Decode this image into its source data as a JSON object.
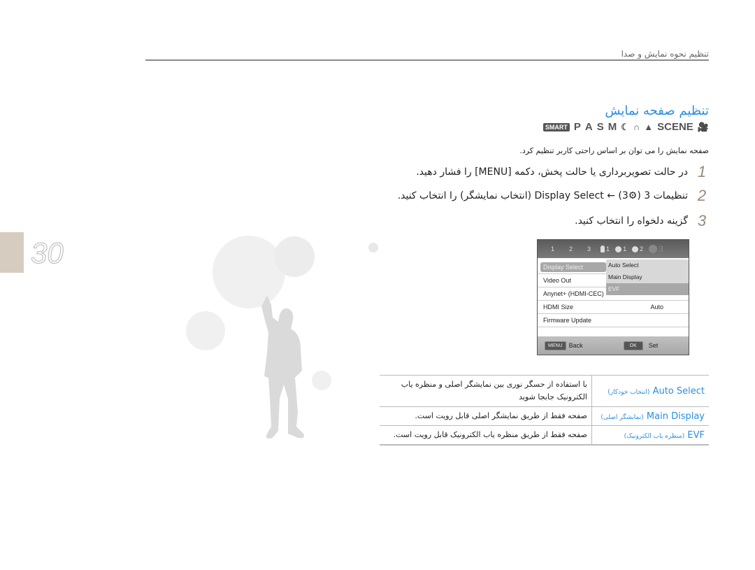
{
  "header": {
    "section_title": "تنظیم نحوه نمایش و صدا"
  },
  "page": {
    "number": "30"
  },
  "content": {
    "title": "تنظیم صفحه نمایش",
    "mode_icons": [
      "smart-mode-icon",
      "P",
      "A",
      "S",
      "M",
      "night-mode-icon",
      "beauty-mode-icon",
      "landscape-mode-icon",
      "SCENE",
      "movie-mode-icon"
    ],
    "mode_labels": {
      "smart": "SMART",
      "p": "P",
      "a": "A",
      "s": "S",
      "m": "M",
      "night": "☾",
      "beauty": "∩",
      "landscape": "▲",
      "scene": "SCENE",
      "movie": "🎥"
    },
    "intro": "صفحه نمایش را می توان بر اساس راحتی کاربر تنظیم کرد.",
    "steps": [
      {
        "num": "1",
        "text": "در حالت تصویربرداری یا حالت پخش، دکمه [MENU] را فشار دهید."
      },
      {
        "num": "2",
        "text": "تنظیمات 3 (⚙3) ← Display Select (انتخاب نمایشگر) را انتخاب کنید."
      },
      {
        "num": "3",
        "text": "گزینه دلخواه را انتخاب کنید."
      }
    ]
  },
  "camera_screen": {
    "tabs": [
      {
        "icon": "camera-icon",
        "label": "1"
      },
      {
        "icon": "camera-icon",
        "label": "2"
      },
      {
        "icon": "camera-icon",
        "label": "3"
      },
      {
        "icon": "person-icon",
        "label": "1"
      },
      {
        "icon": "gear-icon",
        "label": "1"
      },
      {
        "icon": "gear-icon",
        "label": "2"
      },
      {
        "icon": "gear-icon",
        "label": "3"
      }
    ],
    "rows": [
      {
        "label": "Display Select",
        "value": ""
      },
      {
        "label": "Video Out",
        "value": ""
      },
      {
        "label": "Anynet+ (HDMI-CEC)",
        "value": ""
      },
      {
        "label": "HDMI Size",
        "value": "Auto"
      },
      {
        "label": "Firmware Update",
        "value": ""
      }
    ],
    "dropdown": [
      "Auto Select",
      "Main Display",
      "EVF"
    ],
    "footer": {
      "back_key": "MENU",
      "back_label": "Back",
      "set_key": "OK",
      "set_label": "Set"
    }
  },
  "options_table": [
    {
      "option": "Auto Select",
      "option_fa": "(انتخاب خودکار)",
      "desc": "با استفاده از حسگر نوری بین نمایشگر اصلی و منظره یاب الکترونیک جابجا شوید"
    },
    {
      "option": "Main Display",
      "option_fa": "(نمایشگر اصلی)",
      "desc": "صفحه فقط از طریق نمایشگر اصلی قابل رویت است."
    },
    {
      "option": "EVF",
      "option_fa": "(منظره یاب الکترونیک)",
      "desc": "صفحه فقط از طریق منظره یاب الکترونیک قابل رویت است."
    }
  ],
  "colors": {
    "accent": "#2a8ee0",
    "page_tab": "#d6ccbf",
    "step_number": "#9a8878"
  }
}
